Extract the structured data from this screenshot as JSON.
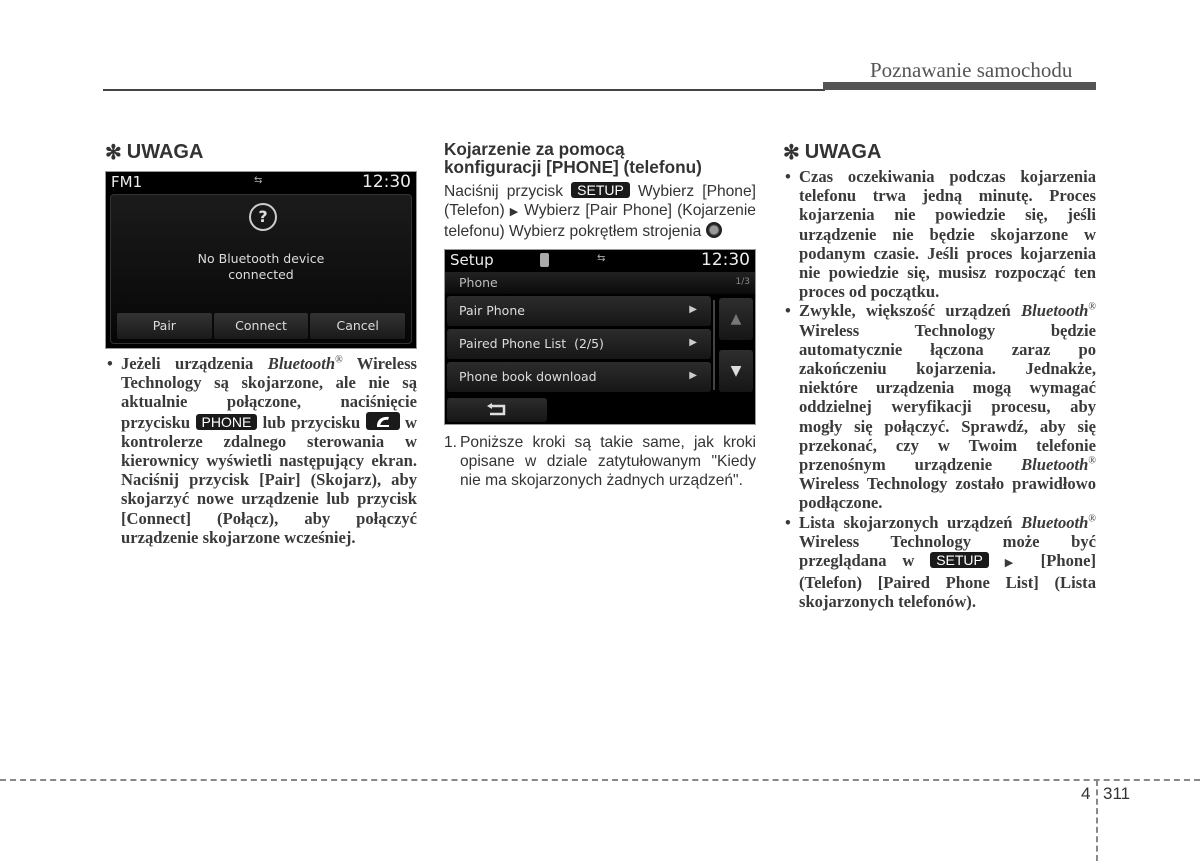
{
  "header": {
    "title": "Poznawanie samochodu"
  },
  "col1": {
    "heading_star": "✻",
    "heading": "UWAGA",
    "screen": {
      "left": "FM1",
      "mid": "⇆",
      "time": "12:30",
      "icon": "?",
      "message_line1": "No Bluetooth device",
      "message_line2": "connected",
      "buttons": [
        "Pair",
        "Connect",
        "Cancel"
      ]
    },
    "bullet": {
      "p1": "Jeżeli urządzenia ",
      "bt": "Bluetooth",
      "reg": "®",
      "p2": " Wireless Technology są skojarzone, ale nie są aktualnie połączone, naciśnięcie przycisku ",
      "key_phone": "PHONE",
      "p3": " lub przycisku ",
      "p4": " w kontrolerze zdalnego sterowania w kierownicy wyświetli następujący ekran. Naciśnij przycisk [Pair] (Skojarz), aby skojarzyć nowe urządzenie lub przycisk [Connect] (Połącz), aby połączyć urządzenie skojarzone wcześniej."
    }
  },
  "col2": {
    "title_line1": "Kojarzenie za pomocą",
    "title_line2": "konfiguracji [PHONE] (telefonu)",
    "intro": {
      "p1": "Naciśnij przycisk ",
      "key_setup": "SETUP",
      "p2": " Wybierz [Phone] (Telefon) ",
      "arrow": "▶",
      "p3": " Wybierz [Pair Phone] (Kojarzenie telefonu) Wybierz pokrętłem strojenia "
    },
    "screen": {
      "title": "Setup",
      "bt_icon": "ʙ",
      "mid": "⇆",
      "time": "12:30",
      "sub": "Phone",
      "page": "1/3",
      "items": [
        "Pair Phone",
        "Paired Phone List  (2/5)",
        "Phone book download"
      ],
      "item_arrow": "▶",
      "up": "▲",
      "down": "▼"
    },
    "step_num": "1.",
    "step_text": "Poniższe kroki są takie same, jak kroki opisane w dziale zatytułowanym \"Kiedy nie ma skojarzonych żadnych urządzeń\"."
  },
  "col3": {
    "heading_star": "✻",
    "heading": "UWAGA",
    "b1": "Czas oczekiwania podczas kojarzenia telefonu trwa jedną minutę. Proces kojarzenia nie powiedzie się, jeśli urządzenie nie będzie skojarzone w podanym czasie. Jeśli proces kojarzenia nie powiedzie się, musisz rozpocząć ten proces od początku.",
    "b2": {
      "p1": "Zwykle, większość urządzeń ",
      "bt": "Bluetooth",
      "reg": "®",
      "p2": " Wireless Technology będzie automatycznie łączona zaraz po zakończeniu kojarzenia. Jednakże, niektóre urządzenia mogą wymagać oddzielnej weryfikacji procesu, aby mogły się połączyć. Sprawdź, aby się przekonać, czy w Twoim telefonie przenośnym urządzenie ",
      "p3": " Wireless Technology zostało prawidłowo podłączone."
    },
    "b3": {
      "p1": "Lista skojarzonych urządzeń ",
      "bt": "Bluetooth",
      "reg": "®",
      "p2": " Wireless Technology może być przeglądana w ",
      "key_setup": "SETUP",
      "arrow": "▶",
      "p3": " [Phone] (Telefon)  [Paired Phone List] (Lista skojarzonych telefonów)."
    }
  },
  "footer": {
    "chapter": "4",
    "page": "311"
  }
}
